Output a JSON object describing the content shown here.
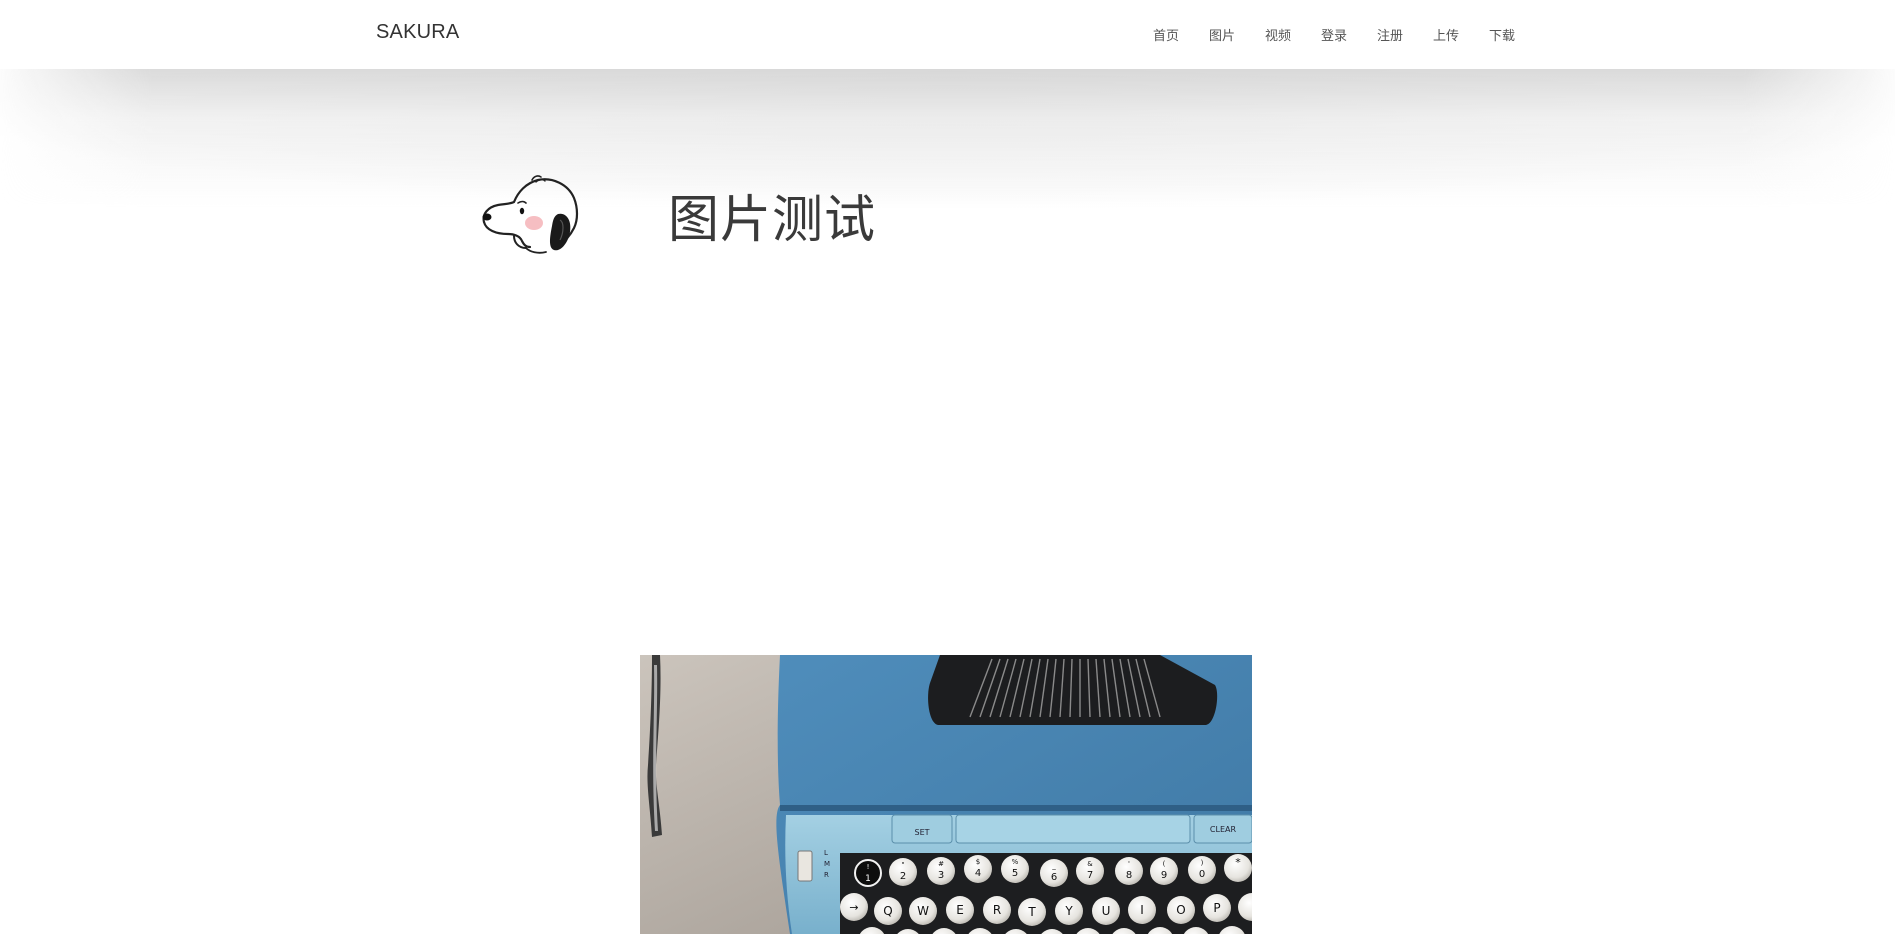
{
  "header": {
    "brand": "SAKURA",
    "nav": [
      {
        "label": "首页"
      },
      {
        "label": "图片"
      },
      {
        "label": "视频"
      },
      {
        "label": "登录"
      },
      {
        "label": "注册"
      },
      {
        "label": "上传"
      },
      {
        "label": "下载"
      }
    ]
  },
  "main": {
    "title": "图片测试",
    "avatar_icon": "snoopy-icon",
    "photo_icon": "typewriter-image",
    "typewriter_keys": {
      "set_label": "SET",
      "clear_label": "CLEAR",
      "number_row": [
        "1",
        "2",
        "3",
        "4",
        "5",
        "6",
        "7",
        "8",
        "9",
        "0"
      ],
      "number_row_shift": [
        "!",
        "\"",
        "#",
        "$",
        "%",
        "_",
        "&",
        "'",
        "(",
        ")"
      ],
      "letter_row": [
        "Q",
        "W",
        "E",
        "R",
        "T",
        "Y",
        "U",
        "I",
        "O",
        "P"
      ],
      "margin_labels": [
        "L",
        "M",
        "R"
      ]
    }
  },
  "colors": {
    "typewriter_body": "#4a86b4",
    "typewriter_panel": "#8fc0d8",
    "desk": "#bdb5ad"
  }
}
